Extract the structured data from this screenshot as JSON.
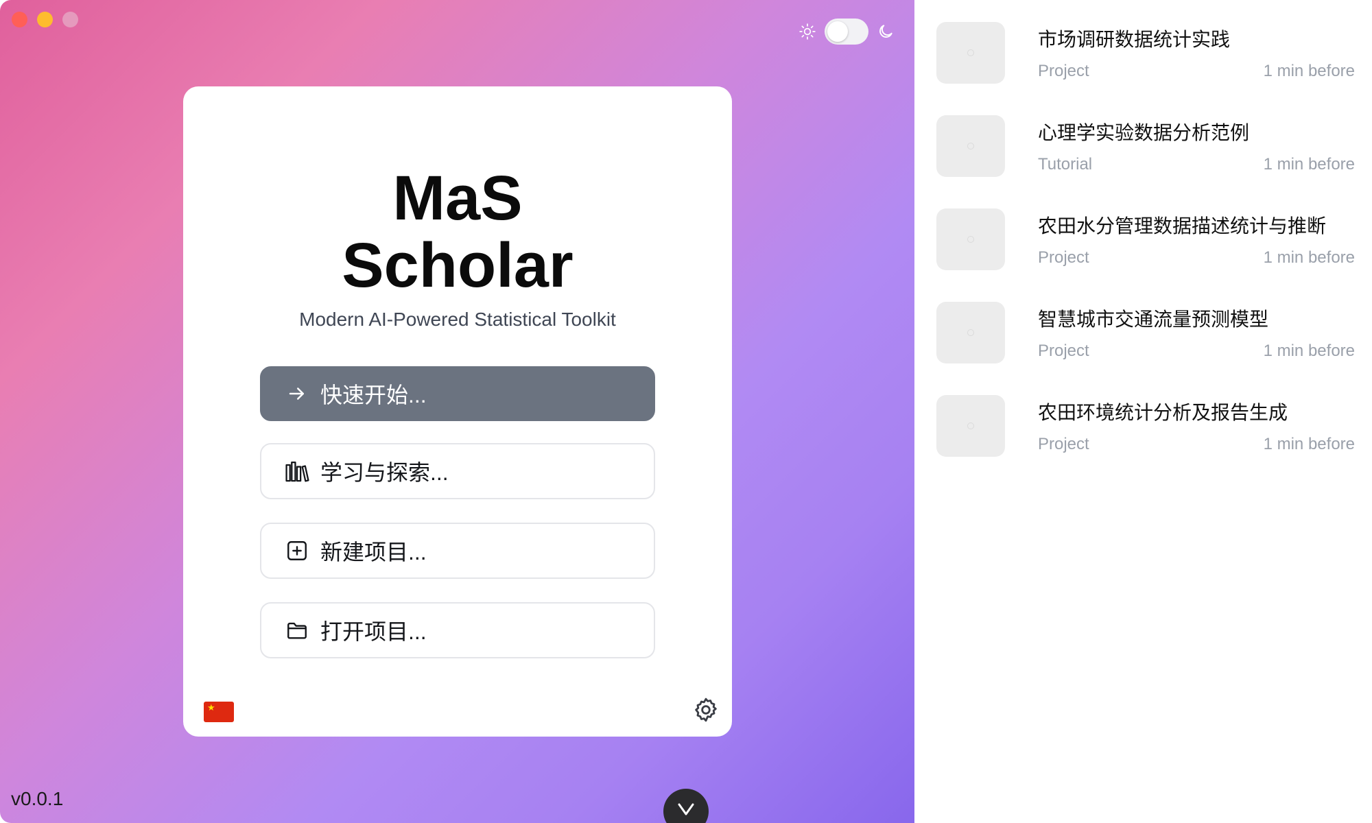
{
  "app": {
    "title_line1": "MaS",
    "title_line2": "Scholar",
    "subtitle": "Modern AI-Powered Statistical Toolkit",
    "version": "v0.0.1"
  },
  "theme": {
    "light_icon": "sun-icon",
    "dark_icon": "moon-icon",
    "mode": "light"
  },
  "actions": {
    "quick_start": "快速开始...",
    "learn_explore": "学习与探索...",
    "new_project": "新建项目...",
    "open_project": "打开项目..."
  },
  "footer": {
    "language_flag": "cn-flag-icon",
    "settings_icon": "gear-icon"
  },
  "recent": [
    {
      "title": "市场调研数据统计实践",
      "type": "Project",
      "time": "1 min before"
    },
    {
      "title": "心理学实验数据分析范例",
      "type": "Tutorial",
      "time": "1 min before"
    },
    {
      "title": "农田水分管理数据描述统计与推断",
      "type": "Project",
      "time": "1 min before"
    },
    {
      "title": "智慧城市交通流量预测模型",
      "type": "Project",
      "time": "1 min before"
    },
    {
      "title": "农田环境统计分析及报告生成",
      "type": "Project",
      "time": "1 min before"
    }
  ],
  "colors": {
    "primary_button": "#6b7380",
    "gradient_start": "#e0609c",
    "gradient_end": "#8867ec"
  }
}
